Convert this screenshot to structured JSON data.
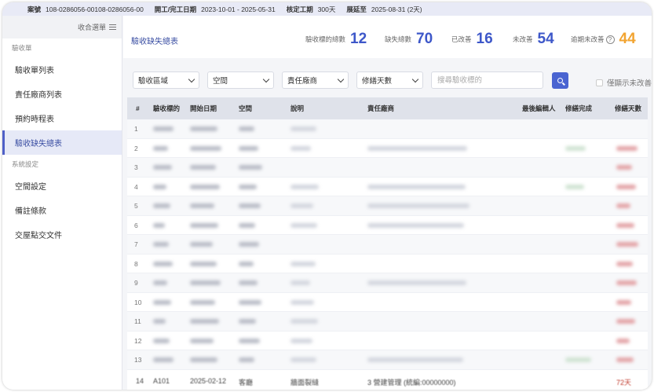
{
  "infobar": {
    "case_label": "案號",
    "case_value": "108-0286056-00108-0286056-00",
    "period_label": "開工/完工日期",
    "period_value": "2023-10-01 - 2025-05-31",
    "days_label": "核定工期",
    "days_value": "300天",
    "extend_label": "展延至",
    "extend_value": "2025-08-31 (2天)"
  },
  "sidebar": {
    "collapse_label": "收合選單",
    "section1": "驗收單",
    "items1": [
      "驗收單列表",
      "責任廠商列表",
      "預約時程表",
      "驗收缺失總表"
    ],
    "section2": "系統設定",
    "items2": [
      "空間設定",
      "備註條款",
      "交屋點交文件"
    ]
  },
  "header": {
    "title": "驗收缺失總表",
    "stats": [
      {
        "label": "驗收標的總數",
        "value": "12"
      },
      {
        "label": "缺失總數",
        "value": "70"
      },
      {
        "label": "已改善",
        "value": "16"
      },
      {
        "label": "未改善",
        "value": "54"
      },
      {
        "label": "逾期未改善",
        "value": "44"
      }
    ]
  },
  "filters": {
    "area": "驗收區域",
    "space": "空間",
    "vendor": "責任廠商",
    "days": "修繕天數",
    "search_placeholder": "搜尋驗收標的",
    "only_open": "僅顯示未改善"
  },
  "table": {
    "headers": [
      "#",
      "驗收標的",
      "開始日期",
      "空間",
      "說明",
      "責任廠商",
      "最後編輯人",
      "修繕完成",
      "修繕天數"
    ],
    "row_numbers": [
      "1",
      "2",
      "3",
      "4",
      "5",
      "6",
      "7",
      "8",
      "9",
      "10",
      "11",
      "12",
      "13"
    ],
    "last_row": [
      "14",
      "A101",
      "2025-02-12",
      "客廳",
      "牆面裂縫",
      "3 營建管理 (統編:00000000)",
      "72天"
    ]
  },
  "colors": {
    "accent": "#3d57c9",
    "warning": "#f2a431",
    "active_nav": "#4f5fc7"
  }
}
